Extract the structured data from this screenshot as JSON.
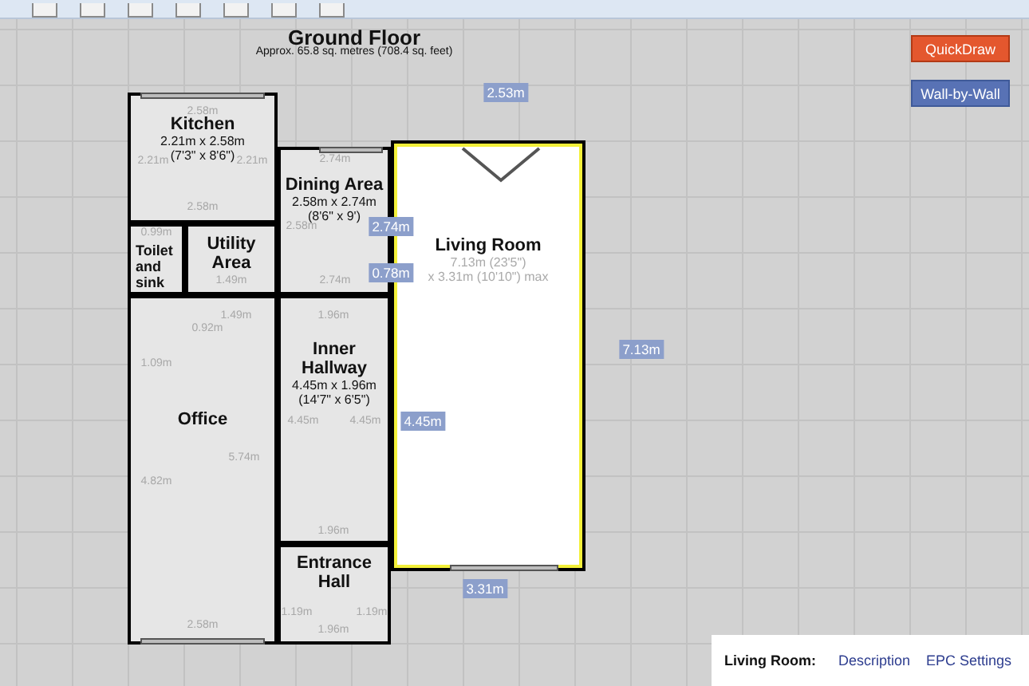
{
  "plan": {
    "title": "Ground Floor",
    "subtitle": "Approx. 65.8 sq. metres (708.4 sq. feet)",
    "rooms": [
      {
        "name": "Kitchen",
        "size": "2.21m x 2.58m",
        "imperial": "(7'3\" x 8'6\")",
        "selected": false
      },
      {
        "name": "Dining Area",
        "size": "2.58m x 2.74m",
        "imperial": "(8'6\" x 9')",
        "selected": false
      },
      {
        "name": "Toilet and sink",
        "selected": false
      },
      {
        "name": "Utility Area",
        "selected": false
      },
      {
        "name": "Office",
        "selected": false
      },
      {
        "name": "Inner Hallway",
        "size": "4.45m x 1.96m",
        "imperial": "(14'7\" x 6'5\")",
        "selected": false
      },
      {
        "name": "Entrance Hall",
        "selected": false
      },
      {
        "name": "Living Room",
        "size": "7.13m (23'5\")",
        "imperial": "x 3.31m (10'10\") max",
        "selected": true
      }
    ],
    "measurements": [
      "2.58m",
      "2.21m",
      "2.21m",
      "2.58m",
      "2.74m",
      "2.58m",
      "2.74m",
      "0.99m",
      "1.49m",
      "1.49m",
      "0.92m",
      "1.96m",
      "1.09m",
      "4.45m",
      "4.45m",
      "5.74m",
      "4.82m",
      "1.96m",
      "2.58m",
      "1.19m",
      "1.19m",
      "1.96m"
    ],
    "tags": [
      "2.53m",
      "2.74m",
      "0.78m",
      "7.13m",
      "4.45m",
      "3.31m"
    ]
  },
  "buttons": [
    {
      "label": "QuickDraw",
      "kind": "quick"
    },
    {
      "label": "Wall-by-Wall",
      "kind": "wall"
    }
  ],
  "panel": {
    "room": "Living Room:",
    "links": [
      "Description",
      "EPC Settings"
    ]
  }
}
